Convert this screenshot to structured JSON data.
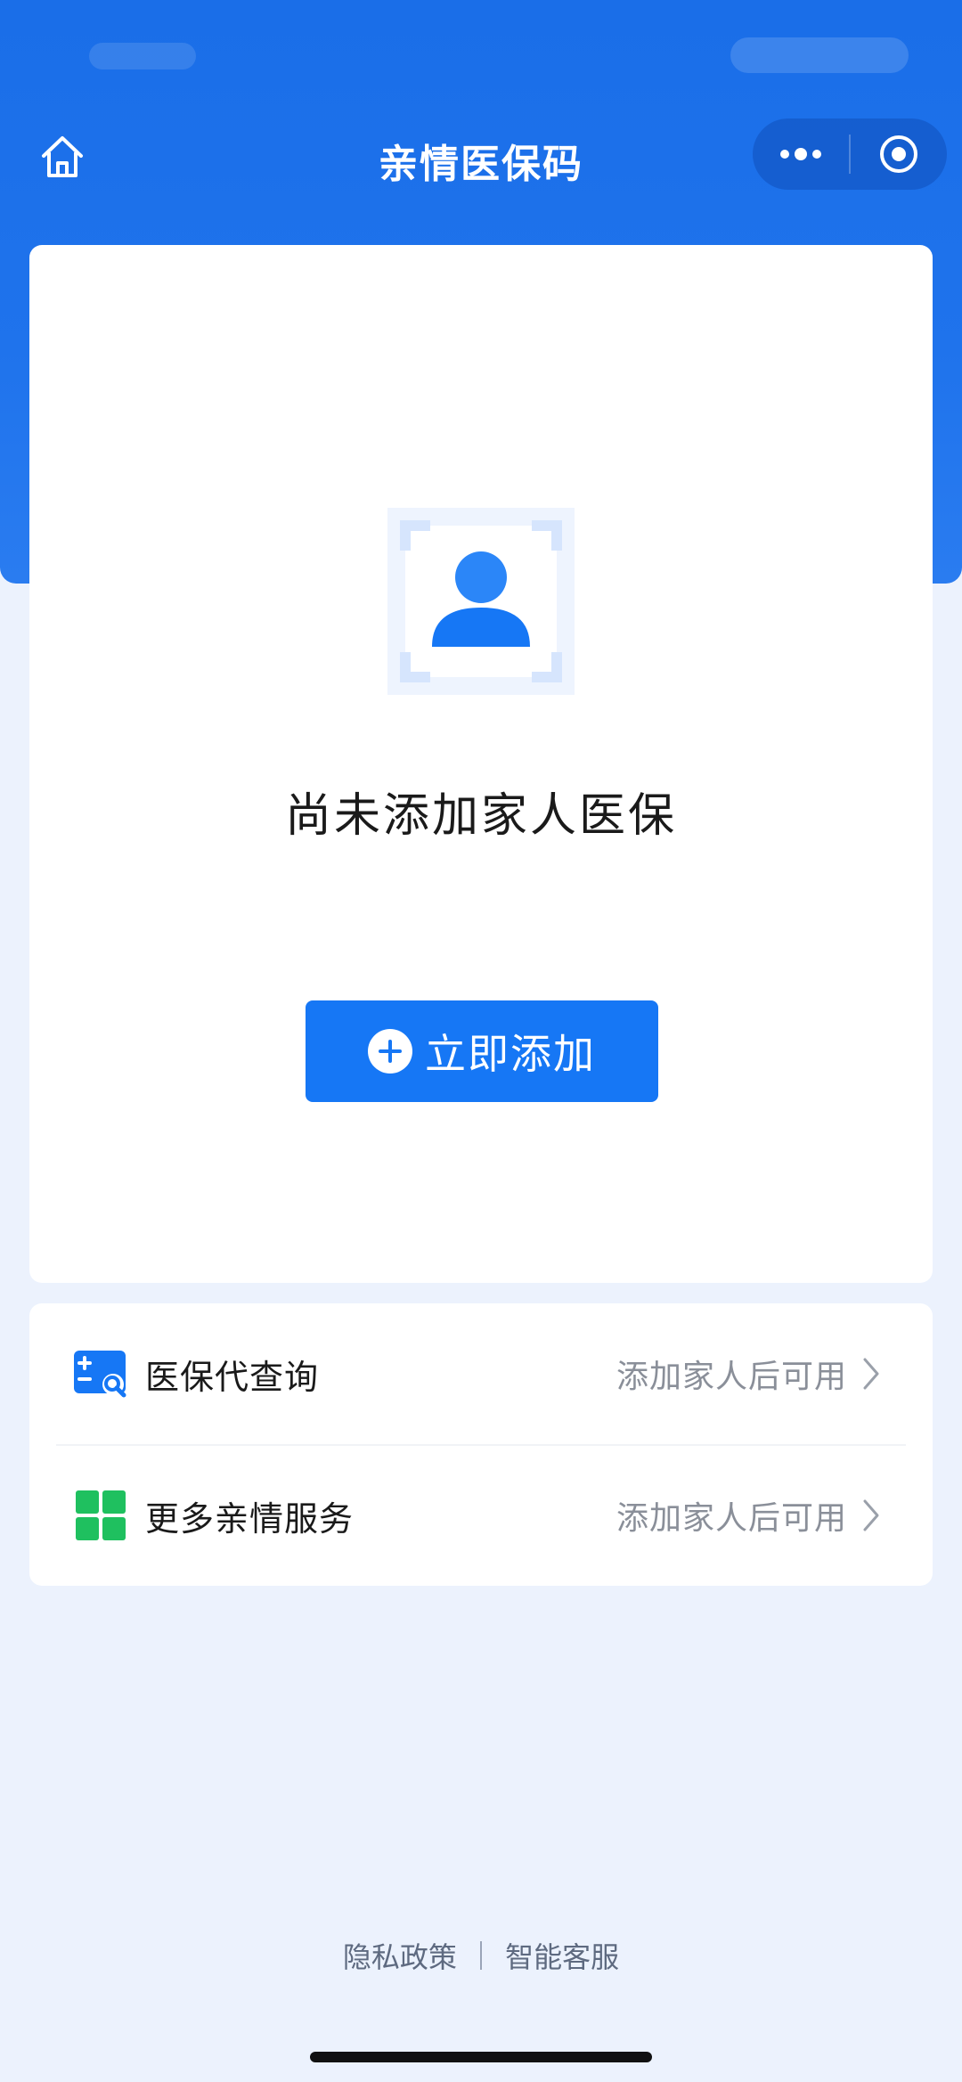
{
  "nav": {
    "title": "亲情医保码"
  },
  "main": {
    "empty_text": "尚未添加家人医保",
    "add_button_label": "立即添加"
  },
  "services": [
    {
      "title": "医保代查询",
      "hint": "添加家人后可用"
    },
    {
      "title": "更多亲情服务",
      "hint": "添加家人后可用"
    }
  ],
  "footer": {
    "privacy": "隐私政策",
    "service": "智能客服"
  },
  "colors": {
    "primary": "#1677f5",
    "header": "#1a6ee8",
    "green": "#1fc05f",
    "background": "#ecf2fd"
  }
}
